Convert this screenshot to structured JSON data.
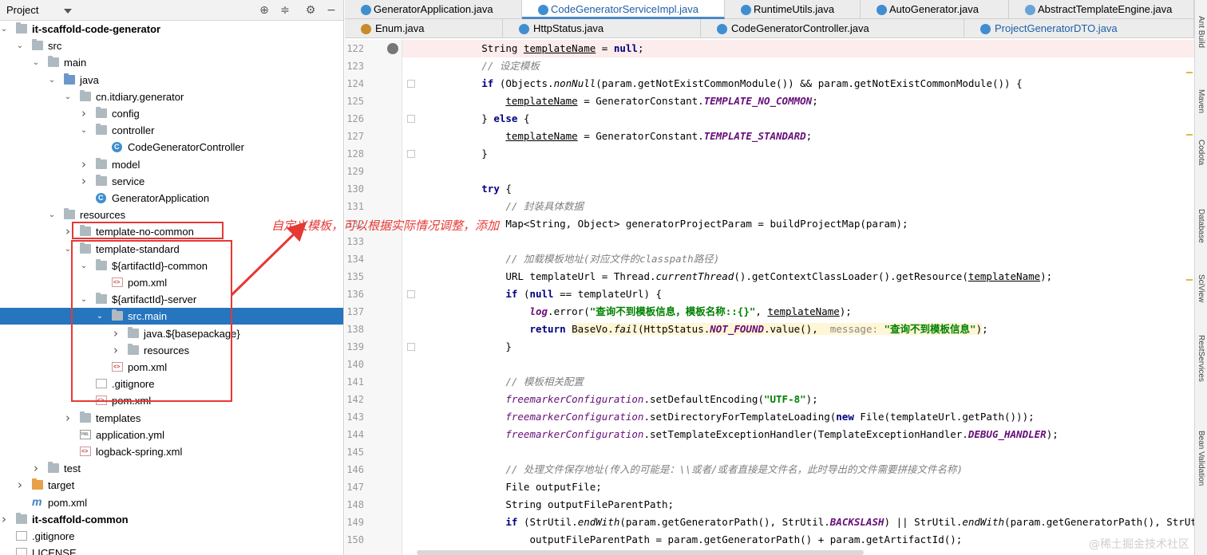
{
  "project_panel": {
    "title": "Project",
    "header_icons": [
      "crosshair-icon",
      "collapse-all-icon",
      "gear-icon",
      "hide-icon"
    ],
    "tree": [
      {
        "label": "it-scaffold-code-generator",
        "indent": 0,
        "chev": "down",
        "icon": "module",
        "bold": true
      },
      {
        "label": "src",
        "indent": 1,
        "chev": "down",
        "icon": "folder"
      },
      {
        "label": "main",
        "indent": 2,
        "chev": "down",
        "icon": "folder"
      },
      {
        "label": "java",
        "indent": 3,
        "chev": "down",
        "icon": "folder-src"
      },
      {
        "label": "cn.itdiary.generator",
        "indent": 4,
        "chev": "down",
        "icon": "package"
      },
      {
        "label": "config",
        "indent": 5,
        "chev": "right",
        "icon": "package"
      },
      {
        "label": "controller",
        "indent": 5,
        "chev": "down",
        "icon": "package"
      },
      {
        "label": "CodeGeneratorController",
        "indent": 6,
        "chev": "",
        "icon": "class"
      },
      {
        "label": "model",
        "indent": 5,
        "chev": "right",
        "icon": "package"
      },
      {
        "label": "service",
        "indent": 5,
        "chev": "right",
        "icon": "package"
      },
      {
        "label": "GeneratorApplication",
        "indent": 5,
        "chev": "",
        "icon": "class"
      },
      {
        "label": "resources",
        "indent": 3,
        "chev": "down",
        "icon": "folder"
      },
      {
        "label": "template-no-common",
        "indent": 4,
        "chev": "right",
        "icon": "folder"
      },
      {
        "label": "template-standard",
        "indent": 4,
        "chev": "down",
        "icon": "folder"
      },
      {
        "label": "${artifactId}-common",
        "indent": 5,
        "chev": "down",
        "icon": "folder"
      },
      {
        "label": "pom.xml",
        "indent": 6,
        "chev": "",
        "icon": "xml"
      },
      {
        "label": "${artifactId}-server",
        "indent": 5,
        "chev": "down",
        "icon": "folder"
      },
      {
        "label": "src.main",
        "indent": 6,
        "chev": "down",
        "icon": "folder",
        "selected": true
      },
      {
        "label": "java.${basepackage}",
        "indent": 7,
        "chev": "right",
        "icon": "folder"
      },
      {
        "label": "resources",
        "indent": 7,
        "chev": "right",
        "icon": "folder"
      },
      {
        "label": "pom.xml",
        "indent": 6,
        "chev": "",
        "icon": "xml"
      },
      {
        "label": ".gitignore",
        "indent": 5,
        "chev": "",
        "icon": "file"
      },
      {
        "label": "pom.xml",
        "indent": 5,
        "chev": "",
        "icon": "xml"
      },
      {
        "label": "templates",
        "indent": 4,
        "chev": "right",
        "icon": "folder"
      },
      {
        "label": "application.yml",
        "indent": 4,
        "chev": "",
        "icon": "yml"
      },
      {
        "label": "logback-spring.xml",
        "indent": 4,
        "chev": "",
        "icon": "xml"
      },
      {
        "label": "test",
        "indent": 2,
        "chev": "right",
        "icon": "folder"
      },
      {
        "label": "target",
        "indent": 1,
        "chev": "right",
        "icon": "folder-orange"
      },
      {
        "label": "pom.xml",
        "indent": 1,
        "chev": "",
        "icon": "maven"
      },
      {
        "label": "it-scaffold-common",
        "indent": 0,
        "chev": "right",
        "icon": "module",
        "bold": true
      },
      {
        "label": ".gitignore",
        "indent": 0,
        "chev": "",
        "icon": "file"
      },
      {
        "label": "LICENSE",
        "indent": 0,
        "chev": "",
        "icon": "file"
      }
    ]
  },
  "annotation": {
    "text": "自定义模板，可以根据实际情况调整，添加",
    "color": "#e53935"
  },
  "editor": {
    "tabs_row1": [
      {
        "label": "GeneratorApplication.java",
        "active": false,
        "icon": "class"
      },
      {
        "label": "CodeGeneratorServiceImpl.java",
        "active": true,
        "icon": "class"
      },
      {
        "label": "RuntimeUtils.java",
        "active": false,
        "icon": "class"
      },
      {
        "label": "AutoGenerator.java",
        "active": false,
        "icon": "class"
      },
      {
        "label": "AbstractTemplateEngine.java",
        "active": false,
        "icon": "abstract"
      }
    ],
    "tabs_row2": [
      {
        "label": "Enum.java",
        "active": false,
        "icon": "enum"
      },
      {
        "label": "HttpStatus.java",
        "active": false,
        "icon": "class"
      },
      {
        "label": "CodeGeneratorController.java",
        "active": false,
        "icon": "class"
      },
      {
        "label": "ProjectGeneratorDTO.java",
        "active": false,
        "icon": "class",
        "blue": true
      }
    ],
    "line_numbers": [
      "122",
      "123",
      "124",
      "125",
      "126",
      "127",
      "128",
      "129",
      "130",
      "131",
      "132",
      "133",
      "134",
      "135",
      "136",
      "137",
      "138",
      "139",
      "140",
      "141",
      "142",
      "143",
      "144",
      "145",
      "146",
      "147",
      "148",
      "149",
      "150"
    ],
    "right_strip_labels": [
      "Ant Build",
      "Maven",
      "Codota",
      "Database",
      "SciView",
      "RestServices",
      "Bean Validation"
    ],
    "watermark": "@稀土掘金技术社区"
  },
  "accent": "#2675bf"
}
